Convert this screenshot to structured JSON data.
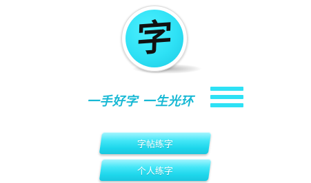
{
  "logo": {
    "character": "字",
    "icon": "calligraphy-logo-icon"
  },
  "slogan": {
    "text": "一手好字 一生光环",
    "menu_icon": "hamburger-menu-icon"
  },
  "buttons": [
    {
      "label": "字帖练字"
    },
    {
      "label": "个人练字"
    }
  ],
  "colors": {
    "accent": "#2ee1f5",
    "slogan_text": "#16b8d4",
    "button_text": "#ffffff",
    "logo_char": "#111111"
  }
}
